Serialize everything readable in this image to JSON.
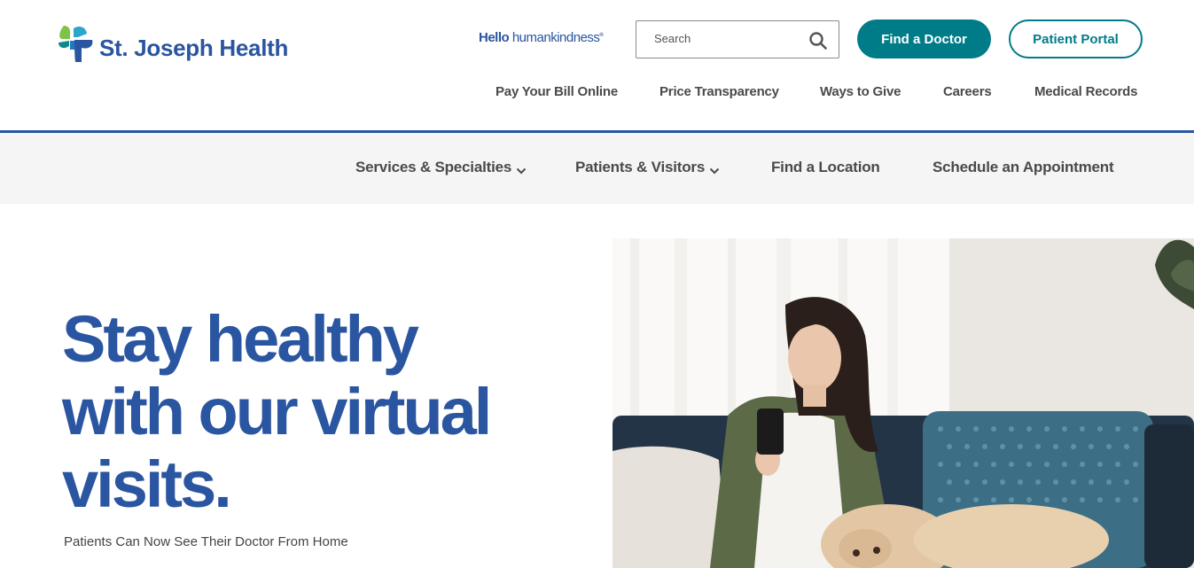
{
  "brand": {
    "name": "St. Joseph Health",
    "tagline_hello": "Hello ",
    "tagline_main": "humankindness",
    "tagline_mark": "®"
  },
  "search": {
    "placeholder": "Search",
    "icon": "search-icon"
  },
  "header_buttons": {
    "find_doctor": "Find a Doctor",
    "patient_portal": "Patient Portal"
  },
  "utility_nav": [
    {
      "label": "Pay Your Bill Online"
    },
    {
      "label": "Price Transparency"
    },
    {
      "label": "Ways to Give"
    },
    {
      "label": "Careers"
    },
    {
      "label": "Medical Records"
    }
  ],
  "main_nav": [
    {
      "label": "Services & Specialties",
      "has_dropdown": true
    },
    {
      "label": "Patients & Visitors",
      "has_dropdown": true
    },
    {
      "label": "Find a Location",
      "has_dropdown": false
    },
    {
      "label": "Schedule an Appointment",
      "has_dropdown": false
    }
  ],
  "hero": {
    "title_line1": "Stay healthy",
    "title_line2": "with our virtual",
    "title_line3": "visits.",
    "subtitle": "Patients Can Now See Their Doctor From Home"
  },
  "colors": {
    "brand_blue": "#2a55a0",
    "teal": "#007c89",
    "nav_bg": "#f5f5f5"
  }
}
